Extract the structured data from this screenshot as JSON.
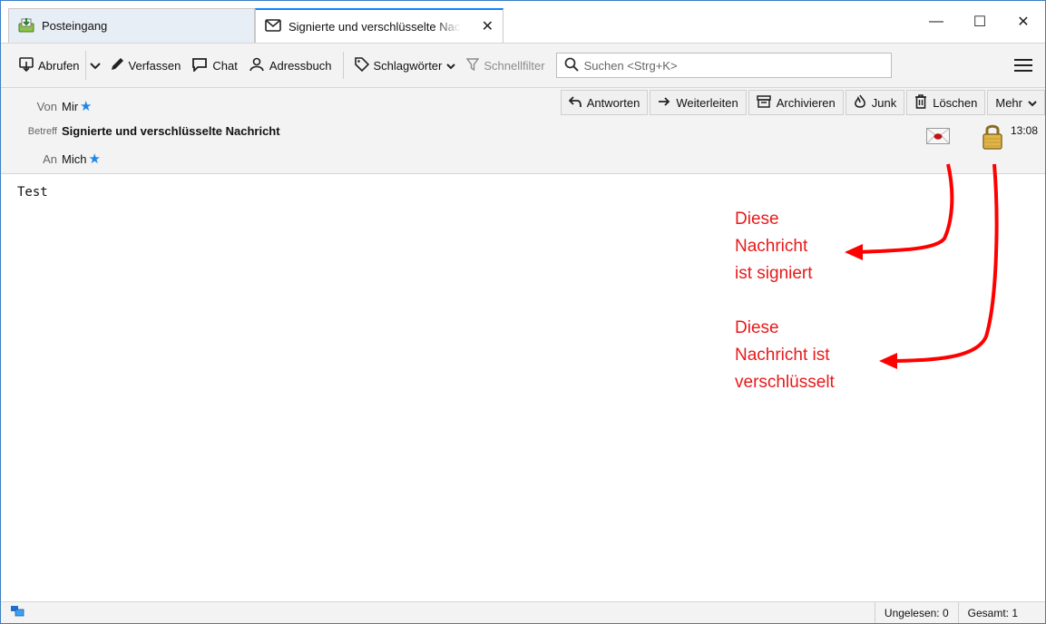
{
  "tabs": [
    {
      "label": "Posteingang",
      "icon": "inbox-icon",
      "active": false
    },
    {
      "label": "Signierte und verschlüsselte Nachricht",
      "icon": "envelope-icon",
      "active": true
    }
  ],
  "window_controls": {
    "minimize": "—",
    "maximize": "☐",
    "close": "✕"
  },
  "toolbar": {
    "get_messages": "Abrufen",
    "compose": "Verfassen",
    "chat": "Chat",
    "address_book": "Adressbuch",
    "tags": "Schlagwörter",
    "quick_filter": "Schnellfilter",
    "search_placeholder": "Suchen <Strg+K>"
  },
  "header": {
    "from_label": "Von",
    "from_value": "Mir",
    "subject_label": "Betreff",
    "subject_value": "Signierte und verschlüsselte Nachricht",
    "to_label": "An",
    "to_value": "Mich",
    "time": "13:08",
    "buttons": {
      "reply": "Antworten",
      "forward": "Weiterleiten",
      "archive": "Archivieren",
      "junk": "Junk",
      "delete": "Löschen",
      "more": "Mehr"
    }
  },
  "body": {
    "text": "Test"
  },
  "annotations": {
    "signed": "Diese\nNachricht\nist signiert",
    "encrypted": "Diese\nNachricht ist\nverschlüsselt",
    "color": "#e8191a"
  },
  "statusbar": {
    "unread": "Ungelesen: 0",
    "total": "Gesamt: 1"
  },
  "colors": {
    "accent": "#0a84ff",
    "star": "#1e88e5"
  }
}
